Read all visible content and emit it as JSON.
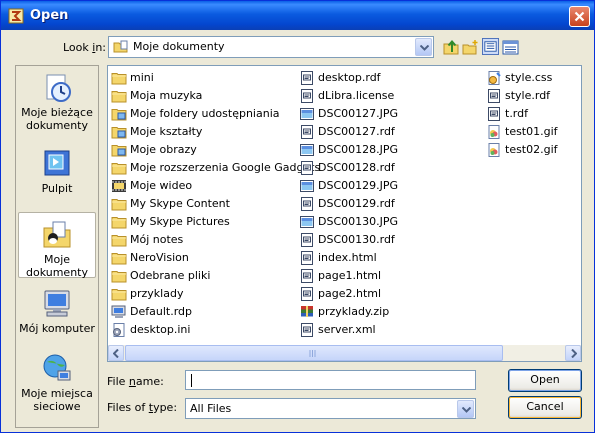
{
  "window": {
    "title": "Open",
    "close_label": "Close"
  },
  "look_in": {
    "label_pre": "Look ",
    "label_key": "i",
    "label_post": "n:",
    "value": "Moje dokumenty"
  },
  "places": [
    {
      "label": "Moje bieżące dokumenty",
      "icon": "recent-documents-icon"
    },
    {
      "label": "Pulpit",
      "icon": "desktop-icon"
    },
    {
      "label": "Moje dokumenty",
      "icon": "my-documents-icon"
    },
    {
      "label": "Mój komputer",
      "icon": "my-computer-icon"
    },
    {
      "label": "Moje miejsca sieciowe",
      "icon": "network-places-icon"
    }
  ],
  "files": {
    "column1": [
      {
        "name": "mini",
        "type": "folder"
      },
      {
        "name": "Moja muzyka",
        "type": "folder"
      },
      {
        "name": "Moje foldery udostępniania",
        "type": "special-folder"
      },
      {
        "name": "Moje kształty",
        "type": "special-folder"
      },
      {
        "name": "Moje obrazy",
        "type": "special-folder"
      },
      {
        "name": "Moje rozszerzenia Google Gadgets",
        "type": "folder"
      },
      {
        "name": "Moje wideo",
        "type": "video-folder"
      },
      {
        "name": "My Skype Content",
        "type": "folder"
      },
      {
        "name": "My Skype Pictures",
        "type": "folder"
      },
      {
        "name": "Mój notes",
        "type": "folder"
      },
      {
        "name": "NeroVision",
        "type": "folder"
      },
      {
        "name": "Odebrane pliki",
        "type": "folder"
      },
      {
        "name": "przyklady",
        "type": "folder"
      },
      {
        "name": "Default.rdp",
        "type": "rdp"
      },
      {
        "name": "desktop.ini",
        "type": "ini"
      }
    ],
    "column2": [
      {
        "name": "desktop.rdf",
        "type": "doc"
      },
      {
        "name": "dLibra.license",
        "type": "doc"
      },
      {
        "name": "DSC00127.JPG",
        "type": "image"
      },
      {
        "name": "DSC00127.rdf",
        "type": "doc"
      },
      {
        "name": "DSC00128.JPG",
        "type": "image"
      },
      {
        "name": "DSC00128.rdf",
        "type": "doc"
      },
      {
        "name": "DSC00129.JPG",
        "type": "image"
      },
      {
        "name": "DSC00129.rdf",
        "type": "doc"
      },
      {
        "name": "DSC00130.JPG",
        "type": "image"
      },
      {
        "name": "DSC00130.rdf",
        "type": "doc"
      },
      {
        "name": "index.html",
        "type": "doc"
      },
      {
        "name": "page1.html",
        "type": "doc"
      },
      {
        "name": "page2.html",
        "type": "doc"
      },
      {
        "name": "przyklady.zip",
        "type": "zip"
      },
      {
        "name": "server.xml",
        "type": "doc"
      }
    ],
    "column3": [
      {
        "name": "style.css",
        "type": "css"
      },
      {
        "name": "style.rdf",
        "type": "doc"
      },
      {
        "name": "t.rdf",
        "type": "doc"
      },
      {
        "name": "test01.gif",
        "type": "gif"
      },
      {
        "name": "test02.gif",
        "type": "gif"
      }
    ]
  },
  "file_name": {
    "label_pre": "File ",
    "label_key": "n",
    "label_post": "ame:",
    "value": ""
  },
  "files_of_type": {
    "label_pre": "Files of ",
    "label_key": "t",
    "label_post": "ype:",
    "value": "All Files"
  },
  "buttons": {
    "open": "Open",
    "cancel": "Cancel"
  },
  "colors": {
    "titlebar": "#0A5FE6",
    "dialog_bg": "#ECE9D8",
    "folder": "#F4D66B",
    "border": "#7F9DB9"
  }
}
